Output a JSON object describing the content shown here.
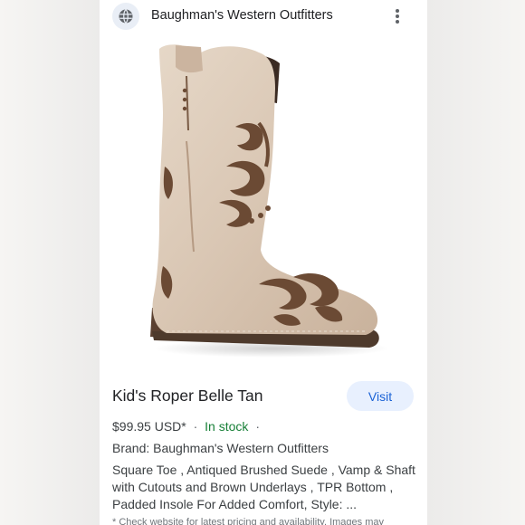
{
  "header": {
    "site_name": "Baughman's Western Outfitters",
    "site_icon": "globe-icon",
    "menu_icon": "more-vert-icon"
  },
  "image": {
    "subject": "boot-image",
    "product_image": "kids-roper-belle-tan-boot"
  },
  "product": {
    "title": "Kid's Roper Belle Tan",
    "visit_label": "Visit",
    "price": "$99.95 USD*",
    "stock_status": "In stock",
    "separator": "·",
    "brand": "Brand: Baughman's Western Outfitters",
    "description": "Square Toe , Antiqued Brushed Suede , Vamp & Shaft with Cutouts and Brown Underlays , TPR Bottom , Padded Insole For Added Comfort, Style: ...",
    "disclaimer": "* Check website for latest pricing and availability. Images may"
  },
  "colors": {
    "visit_bg": "#e8f0fe",
    "visit_text": "#1a62d6",
    "in_stock": "#188038",
    "boot_suede": "#d9c6b3",
    "boot_underlay": "#6b4a34"
  }
}
